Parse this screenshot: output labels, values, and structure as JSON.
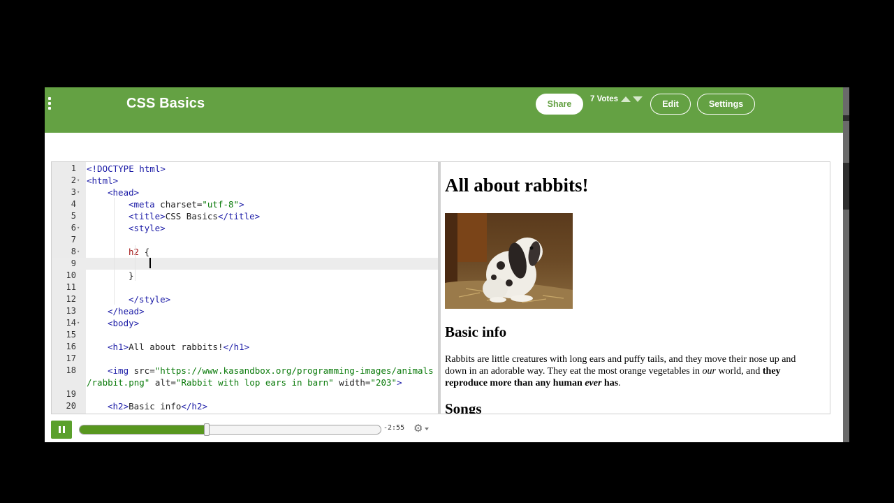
{
  "header": {
    "title": "CSS Basics",
    "share_label": "Share",
    "votes_label": "7 Votes",
    "edit_label": "Edit",
    "settings_label": "Settings"
  },
  "editor": {
    "lines": [
      {
        "num": "1",
        "fold": false,
        "indent": 0,
        "tokens": [
          {
            "c": "t",
            "x": "<!DOCTYPE html>"
          }
        ]
      },
      {
        "num": "2",
        "fold": true,
        "indent": 0,
        "tokens": [
          {
            "c": "t",
            "x": "<html>"
          }
        ]
      },
      {
        "num": "3",
        "fold": true,
        "indent": 1,
        "tokens": [
          {
            "c": "t",
            "x": "<head>"
          }
        ]
      },
      {
        "num": "4",
        "fold": false,
        "indent": 2,
        "tokens": [
          {
            "c": "t",
            "x": "<meta"
          },
          {
            "c": "a",
            "x": " charset="
          },
          {
            "c": "s",
            "x": "\"utf-8\""
          },
          {
            "c": "t",
            "x": ">"
          }
        ]
      },
      {
        "num": "5",
        "fold": false,
        "indent": 2,
        "tokens": [
          {
            "c": "t",
            "x": "<title>"
          },
          {
            "c": "plain",
            "x": "CSS Basics"
          },
          {
            "c": "t",
            "x": "</title>"
          }
        ]
      },
      {
        "num": "6",
        "fold": true,
        "indent": 2,
        "tokens": [
          {
            "c": "t",
            "x": "<style>"
          }
        ]
      },
      {
        "num": "7",
        "fold": false,
        "indent": 0,
        "tokens": []
      },
      {
        "num": "8",
        "fold": true,
        "indent": 2,
        "tokens": [
          {
            "c": "sel",
            "x": "h2"
          },
          {
            "c": "plain",
            "x": " {"
          }
        ]
      },
      {
        "num": "9",
        "fold": false,
        "indent": 0,
        "tokens": [],
        "active": true
      },
      {
        "num": "10",
        "fold": false,
        "indent": 2,
        "tokens": [
          {
            "c": "plain",
            "x": "}"
          }
        ]
      },
      {
        "num": "11",
        "fold": false,
        "indent": 0,
        "tokens": []
      },
      {
        "num": "12",
        "fold": false,
        "indent": 2,
        "tokens": [
          {
            "c": "t",
            "x": "</style>"
          }
        ]
      },
      {
        "num": "13",
        "fold": false,
        "indent": 1,
        "tokens": [
          {
            "c": "t",
            "x": "</head>"
          }
        ]
      },
      {
        "num": "14",
        "fold": true,
        "indent": 1,
        "tokens": [
          {
            "c": "t",
            "x": "<body>"
          }
        ]
      },
      {
        "num": "15",
        "fold": false,
        "indent": 0,
        "tokens": []
      },
      {
        "num": "16",
        "fold": false,
        "indent": 1,
        "tokens": [
          {
            "c": "t",
            "x": "<h1>"
          },
          {
            "c": "plain",
            "x": "All about rabbits!"
          },
          {
            "c": "t",
            "x": "</h1>"
          }
        ]
      },
      {
        "num": "17",
        "fold": false,
        "indent": 0,
        "tokens": []
      },
      {
        "num": "18",
        "fold": false,
        "indent": 1,
        "tokens": [
          {
            "c": "t",
            "x": "<img"
          },
          {
            "c": "a",
            "x": " src="
          },
          {
            "c": "s",
            "x": "\"https://www.kasandbox.org/programming-images/animals"
          }
        ]
      },
      {
        "num": "",
        "fold": false,
        "indent": 0,
        "tokens": [
          {
            "c": "s",
            "x": "/rabbit.png\""
          },
          {
            "c": "a",
            "x": " alt="
          },
          {
            "c": "s",
            "x": "\"Rabbit with lop ears in barn\""
          },
          {
            "c": "a",
            "x": " width="
          },
          {
            "c": "s",
            "x": "\"203\""
          },
          {
            "c": "t",
            "x": ">"
          }
        ]
      },
      {
        "num": "19",
        "fold": false,
        "indent": 0,
        "tokens": []
      },
      {
        "num": "20",
        "fold": false,
        "indent": 1,
        "tokens": [
          {
            "c": "t",
            "x": "<h2>"
          },
          {
            "c": "plain",
            "x": "Basic info"
          },
          {
            "c": "t",
            "x": "</h2>"
          }
        ]
      }
    ]
  },
  "preview": {
    "h1": "All about rabbits!",
    "image_alt": "Rabbit with lop ears in barn",
    "h2": "Basic info",
    "paragraph": {
      "part1": "Rabbits are little creatures with long ears and puffy tails, and they move their nose up and down in an adorable way. They eat the most orange vegetables in ",
      "em": "our",
      "part2": " world, and ",
      "strong1": "they reproduce more than any human ",
      "strong_em": "ever",
      "strong2": " has",
      "end": "."
    },
    "h2b": "Songs"
  },
  "player": {
    "time_remaining": "-2:55",
    "progress": 0.42,
    "settings_icon": "gear-icon"
  },
  "colors": {
    "brand_green": "#64a143",
    "progress_green": "#58971f"
  }
}
